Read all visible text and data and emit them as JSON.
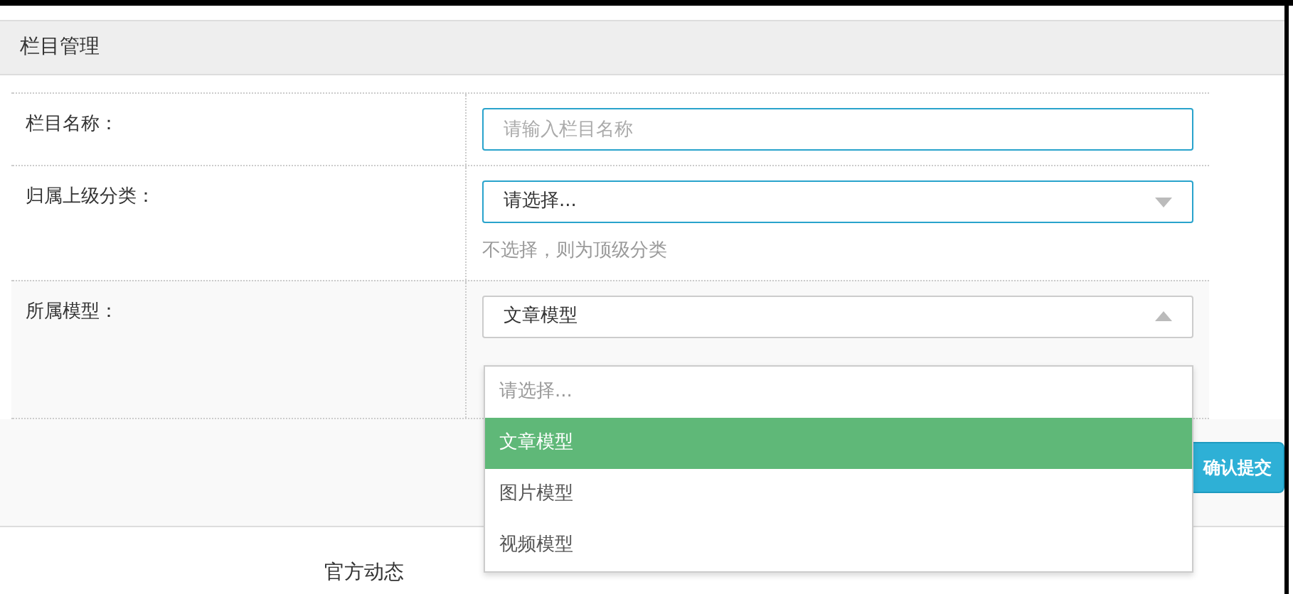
{
  "panel": {
    "title": "栏目管理"
  },
  "fields": [
    {
      "kind": "text",
      "label": "栏目名称：",
      "placeholder": "请输入栏目名称",
      "focused": true
    },
    {
      "kind": "select",
      "label": "归属上级分类：",
      "value": "请选择...",
      "focused": true,
      "open": false,
      "help": "不选择，则为顶级分类"
    },
    {
      "kind": "select",
      "label": "所属模型：",
      "value": "文章模型",
      "focused": false,
      "open": true
    }
  ],
  "dropdown": {
    "options": [
      {
        "label": "请选择...",
        "selected": false,
        "placeholder": true
      },
      {
        "label": "文章模型",
        "selected": true,
        "placeholder": false
      },
      {
        "label": "图片模型",
        "selected": false,
        "placeholder": false
      },
      {
        "label": "视频模型",
        "selected": false,
        "placeholder": false
      }
    ]
  },
  "submit_button": "确认提交",
  "footer": {
    "link": "官方动态"
  }
}
